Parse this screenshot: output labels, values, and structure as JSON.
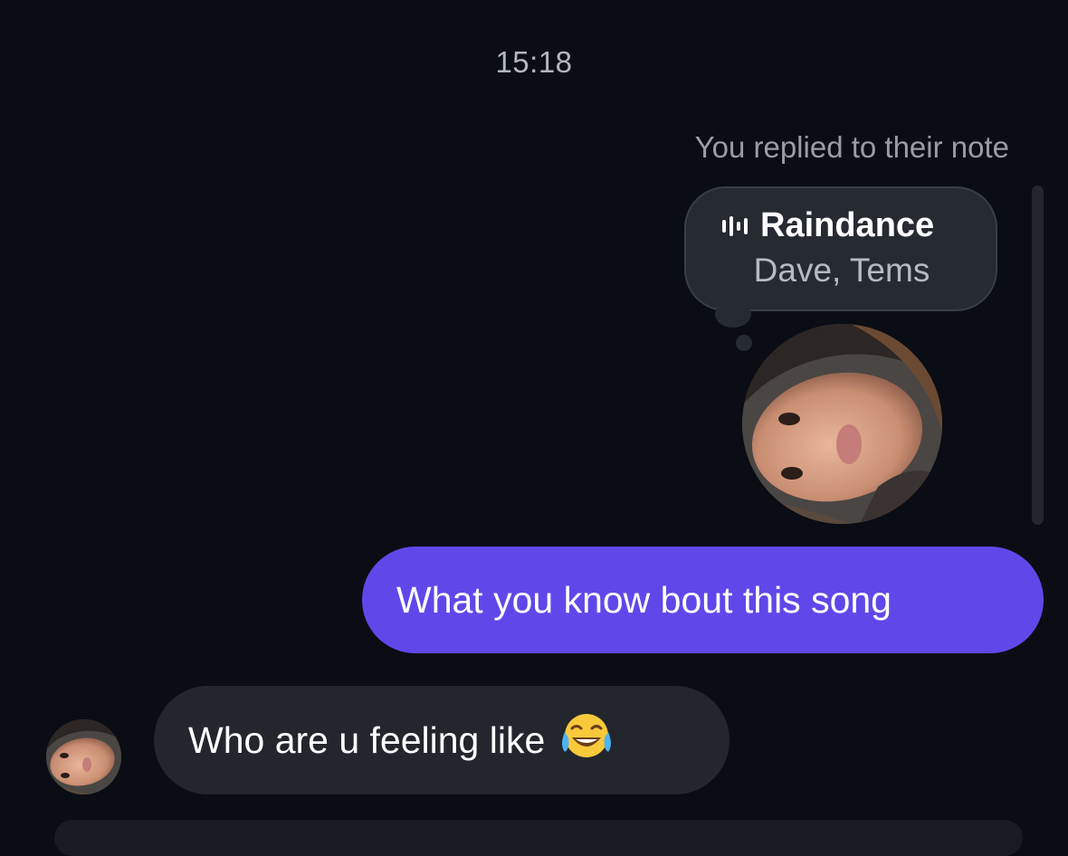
{
  "thread": {
    "timestamp": "15:18",
    "reply_context": "You replied to their note",
    "note": {
      "song_title": "Raindance",
      "artists": "Dave, Tems",
      "icon": "sound-wave-icon"
    },
    "messages": [
      {
        "direction": "sent",
        "text": "What you know bout this song"
      },
      {
        "direction": "received",
        "text": "Who are u feeling like",
        "emoji": "face-with-tears-of-joy"
      }
    ]
  },
  "colors": {
    "background": "#0b0d14",
    "sent_bubble": "#5f48ea",
    "received_bubble": "#23262c",
    "note_bubble": "#262a31"
  }
}
